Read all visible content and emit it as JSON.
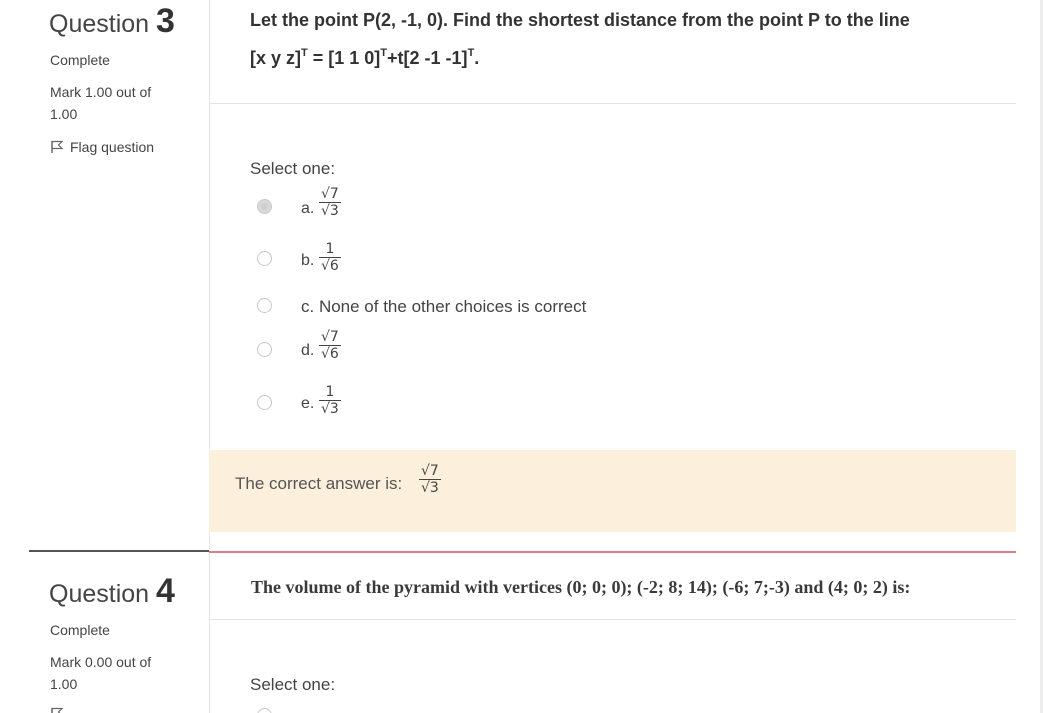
{
  "q3": {
    "label": "Question",
    "number": "3",
    "state": "Complete",
    "mark": "Mark 1.00 out of 1.00",
    "flag_label": "Flag question",
    "text_line1": "Let the point P(2, -1, 0). Find the shortest distance from the point P to the line",
    "text_line2_a": "[x y z]",
    "text_line2_sup1": "T",
    "text_line2_b": " = [1 1 0]",
    "text_line2_sup2": "T",
    "text_line2_c": "+t[2 -1 -1]",
    "text_line2_sup3": "T",
    "text_line2_d": ".",
    "prompt": "Select one:",
    "options": [
      {
        "letter": "a.",
        "num": "√7",
        "den": "√3",
        "checked": true
      },
      {
        "letter": "b.",
        "num": "1",
        "den": "√6",
        "checked": false
      },
      {
        "letter": "c.",
        "text": "c. None of the other choices is correct",
        "checked": false
      },
      {
        "letter": "d.",
        "num": "√7",
        "den": "√6",
        "checked": false
      },
      {
        "letter": "e.",
        "num": "1",
        "den": "√3",
        "checked": false
      }
    ],
    "feedback_label": "The correct answer is:",
    "feedback_num": "√7",
    "feedback_den": "√3"
  },
  "q4": {
    "label": "Question",
    "number": "4",
    "state": "Complete",
    "mark": "Mark 0.00 out of 1.00",
    "text": "The volume of the pyramid with vertices (0; 0; 0); (-2; 8; 14); (-6; 7;-3) and (4; 0; 2) is:",
    "prompt": "Select one:"
  },
  "icons": {
    "flag": "flag-icon"
  }
}
